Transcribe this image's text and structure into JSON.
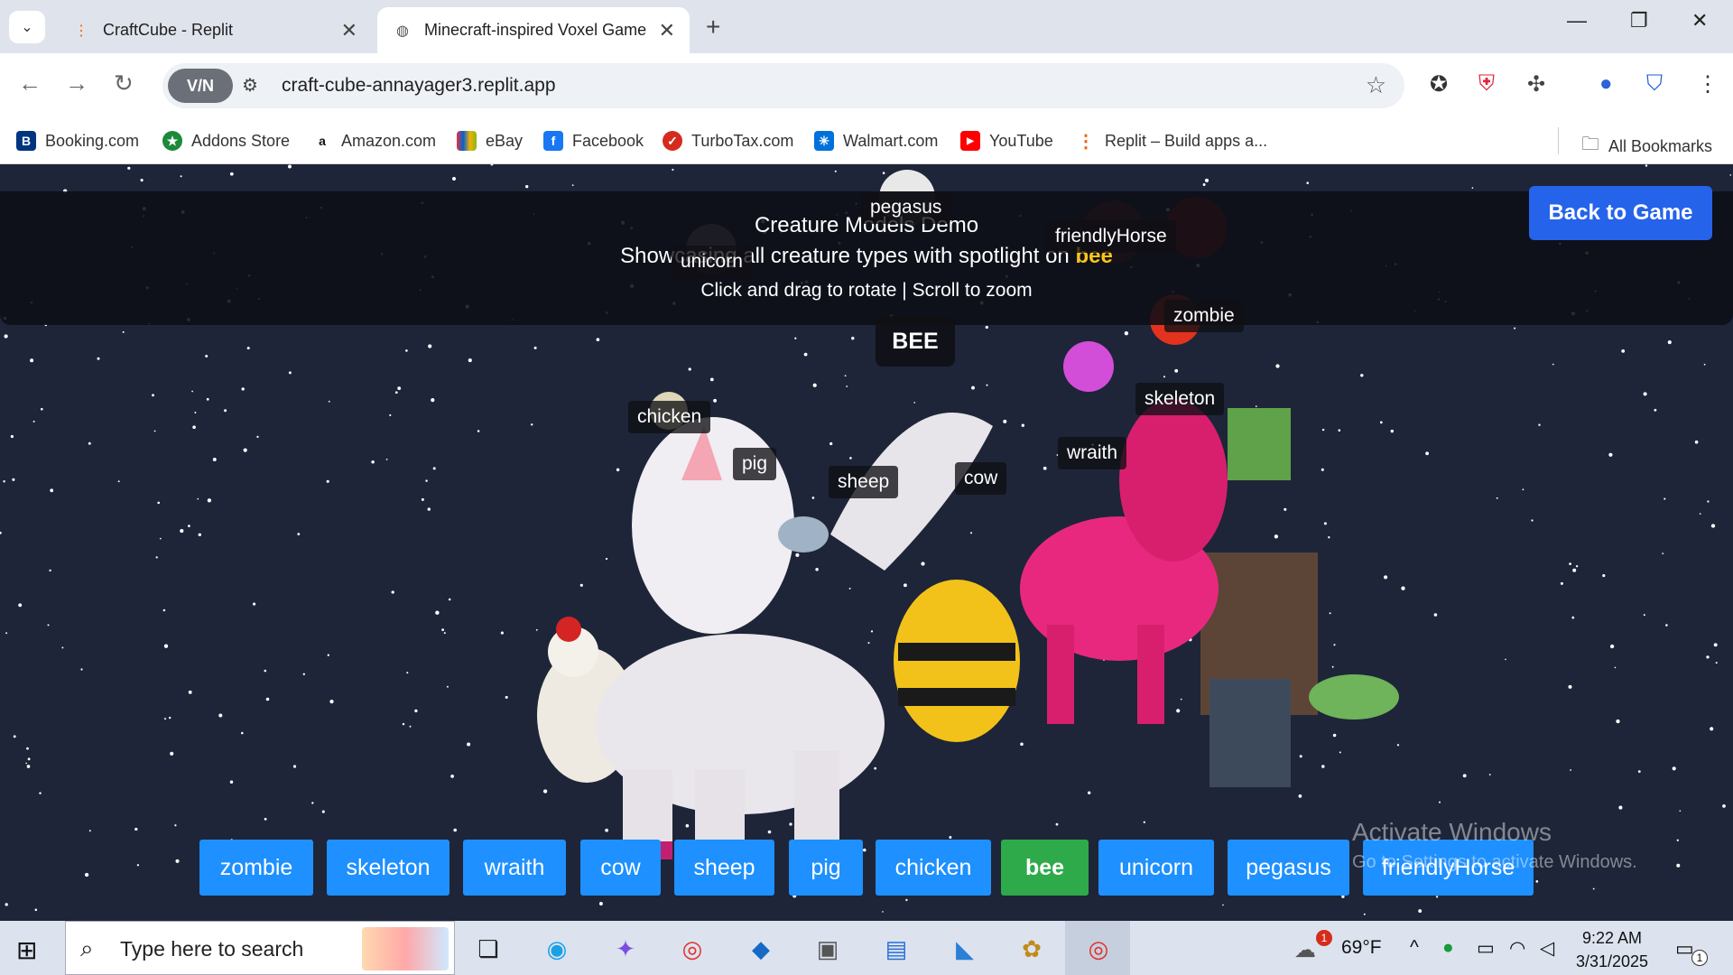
{
  "browser": {
    "tabs": [
      {
        "title": "CraftCube - Replit",
        "active": false
      },
      {
        "title": "Minecraft-inspired Voxel Game",
        "active": true
      }
    ],
    "vpn_label": "V/N",
    "url": "craft-cube-annayager3.replit.app",
    "bookmarks": [
      {
        "label": "Booking.com",
        "color": "#003580",
        "glyph": "B."
      },
      {
        "label": "Addons Store",
        "color": "#1b8a3a",
        "glyph": "★"
      },
      {
        "label": "Amazon.com",
        "color": "#ffffff",
        "glyph": "a"
      },
      {
        "label": "eBay",
        "color": "#e53238",
        "glyph": "▤"
      },
      {
        "label": "Facebook",
        "color": "#1877f2",
        "glyph": "f"
      },
      {
        "label": "TurboTax.com",
        "color": "#d52b1e",
        "glyph": "✓"
      },
      {
        "label": "Walmart.com",
        "color": "#0071dc",
        "glyph": "✳"
      },
      {
        "label": "YouTube",
        "color": "#ff0000",
        "glyph": "▶"
      },
      {
        "label": "Replit – Build apps a...",
        "color": "#f26207",
        "glyph": "⋮"
      }
    ],
    "all_bookmarks": "All Bookmarks"
  },
  "page": {
    "title": "Creature Models Demo",
    "subtitle_prefix": "Showcasing all creature types with spotlight on",
    "spotlight": "bee",
    "hint": "Click and drag to rotate | Scroll to zoom",
    "back_button": "Back to Game",
    "spotlight_label": "BEE",
    "floating_labels": [
      "pegasus",
      "friendlyHorse",
      "unicorn",
      "zombie",
      "skeleton",
      "chicken",
      "wraith",
      "pig",
      "sheep",
      "cow"
    ],
    "creature_buttons": [
      "zombie",
      "skeleton",
      "wraith",
      "cow",
      "sheep",
      "pig",
      "chicken",
      "bee",
      "unicorn",
      "pegasus",
      "friendlyHorse"
    ],
    "active_creature": "bee"
  },
  "watermark": {
    "line1": "Activate Windows",
    "line2": "Go to Settings to activate Windows."
  },
  "taskbar": {
    "search_placeholder": "Type here to search",
    "weather": "69°F",
    "weather_badge": "1",
    "time": "9:22 AM",
    "date": "3/31/2025",
    "notif_count": "1"
  }
}
